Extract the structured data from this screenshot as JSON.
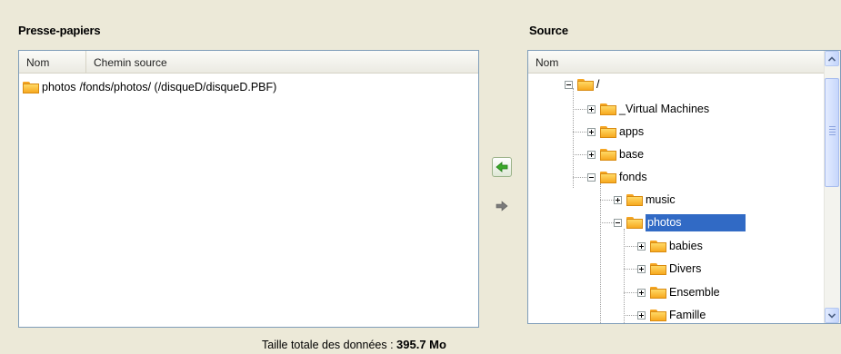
{
  "clipboard": {
    "title": "Presse-papiers",
    "columns": [
      "Nom",
      "Chemin source"
    ],
    "rows": [
      {
        "name": "photos",
        "path": "/fonds/photos/ (/disqueD/disqueD.PBF)"
      }
    ]
  },
  "source": {
    "title": "Source",
    "column": "Nom",
    "tree": [
      {
        "label": "/",
        "expanded": true
      },
      {
        "label": "_Virtual Machines",
        "expanded": false
      },
      {
        "label": "apps",
        "expanded": false
      },
      {
        "label": "base",
        "expanded": false
      },
      {
        "label": "fonds",
        "expanded": true
      },
      {
        "label": "music",
        "expanded": false
      },
      {
        "label": "photos",
        "expanded": true,
        "selected": true
      },
      {
        "label": "babies",
        "expanded": false
      },
      {
        "label": "Divers",
        "expanded": false
      },
      {
        "label": "Ensemble",
        "expanded": false
      },
      {
        "label": "Famille",
        "expanded": false
      }
    ]
  },
  "footer": {
    "label": "Taille totale des données :",
    "value": "395.7 Mo"
  },
  "icons": {
    "add": "arrow-left-icon",
    "remove": "arrow-right-icon",
    "folder": "folder-icon"
  },
  "colors": {
    "selection": "#316ac5",
    "window_bg": "#ece9d8",
    "add_arrow": "#3aa829"
  }
}
